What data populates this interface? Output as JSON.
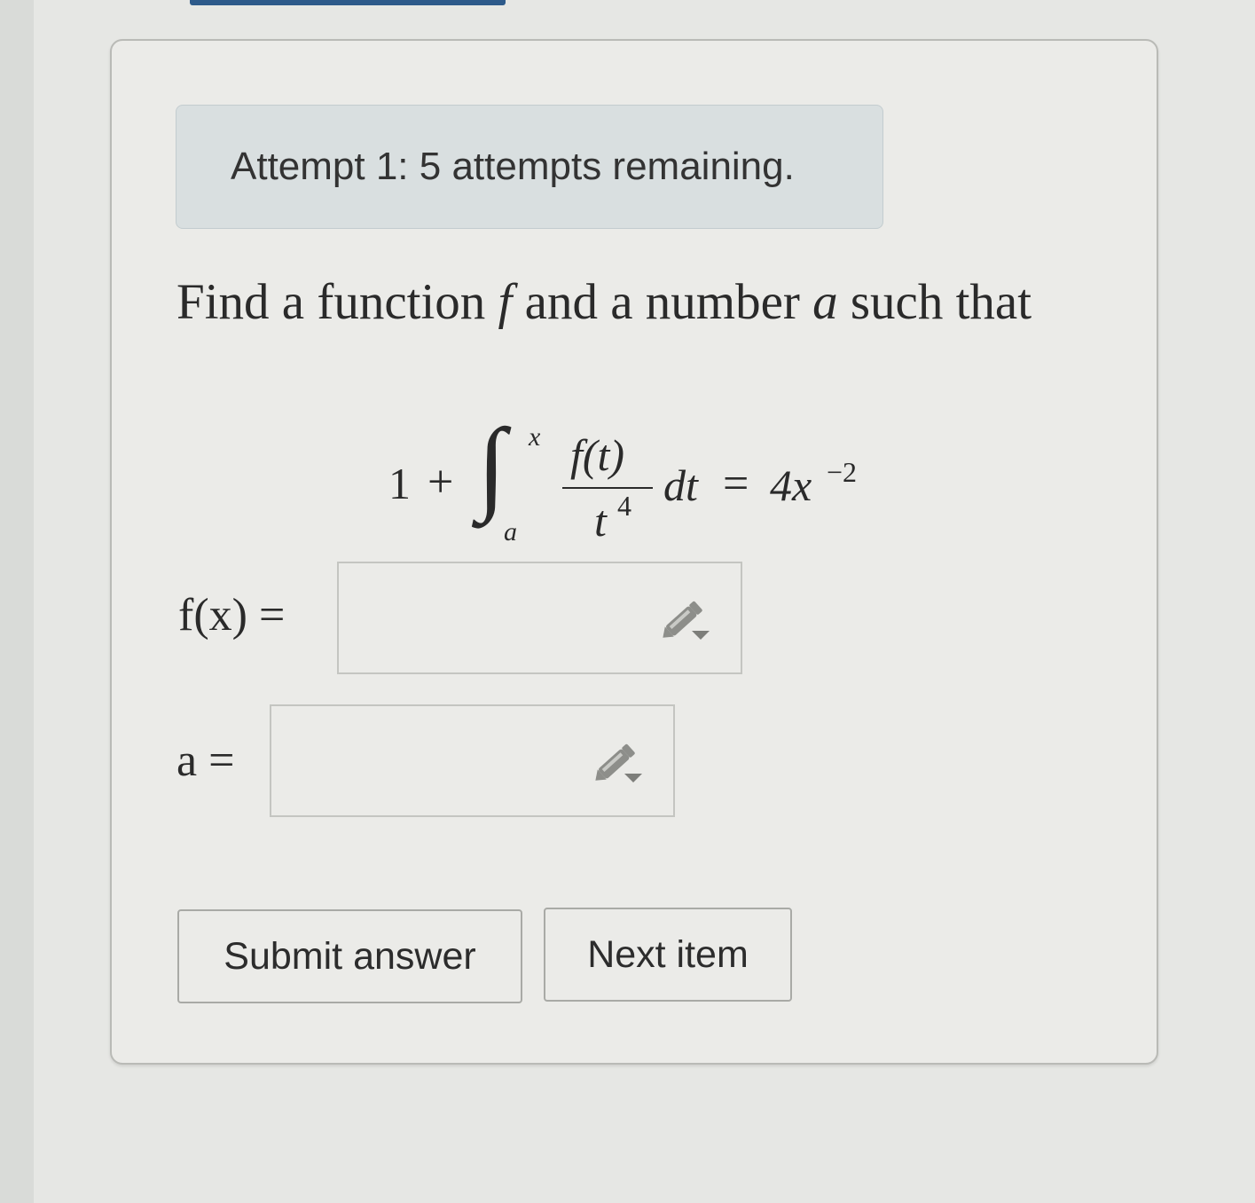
{
  "attempt": {
    "text": "Attempt 1: 5 attempts remaining."
  },
  "question": {
    "prompt_part1": "Find a function ",
    "var_f": "f",
    "prompt_part2": " and a number ",
    "var_a": "a",
    "prompt_part3": " such that"
  },
  "equation": {
    "lhs_const": "1",
    "plus": "+",
    "integral_sign": "∫",
    "upper_limit": "x",
    "lower_limit": "a",
    "numerator": "f(t)",
    "denominator_base": "t",
    "denominator_exp": "4",
    "differential": "dt",
    "equals": "=",
    "rhs": "4x",
    "rhs_exp": "−2"
  },
  "answers": [
    {
      "label": "f(x) =",
      "value": "",
      "placeholder": ""
    },
    {
      "label": "a =",
      "value": "",
      "placeholder": ""
    }
  ],
  "icons": {
    "answer_edit": "pencil-dropdown-icon"
  },
  "buttons": {
    "submit": "Submit answer",
    "next": "Next item"
  },
  "colors": {
    "banner_bg": "#d9dfe0",
    "page_bg": "#ebebe8",
    "accent_tab": "#2d5a8a"
  }
}
